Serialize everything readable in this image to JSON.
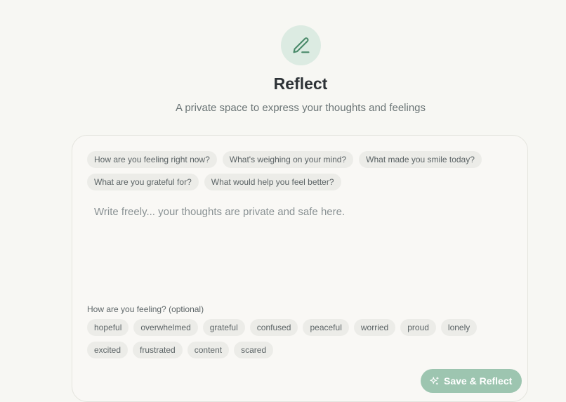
{
  "header": {
    "icon": "pencil-icon",
    "title": "Reflect",
    "subtitle": "A private space to express your thoughts and feelings"
  },
  "prompts": [
    "How are you feeling right now?",
    "What's weighing on your mind?",
    "What made you smile today?",
    "What are you grateful for?",
    "What would help you feel better?"
  ],
  "entry": {
    "placeholder": "Write freely... your thoughts are private and safe here.",
    "value": ""
  },
  "mood": {
    "label": "How are you feeling? (optional)",
    "options": [
      "hopeful",
      "overwhelmed",
      "grateful",
      "confused",
      "peaceful",
      "worried",
      "proud",
      "lonely",
      "excited",
      "frustrated",
      "content",
      "scared"
    ]
  },
  "actions": {
    "save_label": "Save & Reflect",
    "save_icon": "sparkles-icon"
  },
  "colors": {
    "background": "#f7f7f3",
    "accent": "#9dc5b0",
    "icon_circle": "#dcebe2",
    "icon_stroke": "#4a8a6a"
  }
}
